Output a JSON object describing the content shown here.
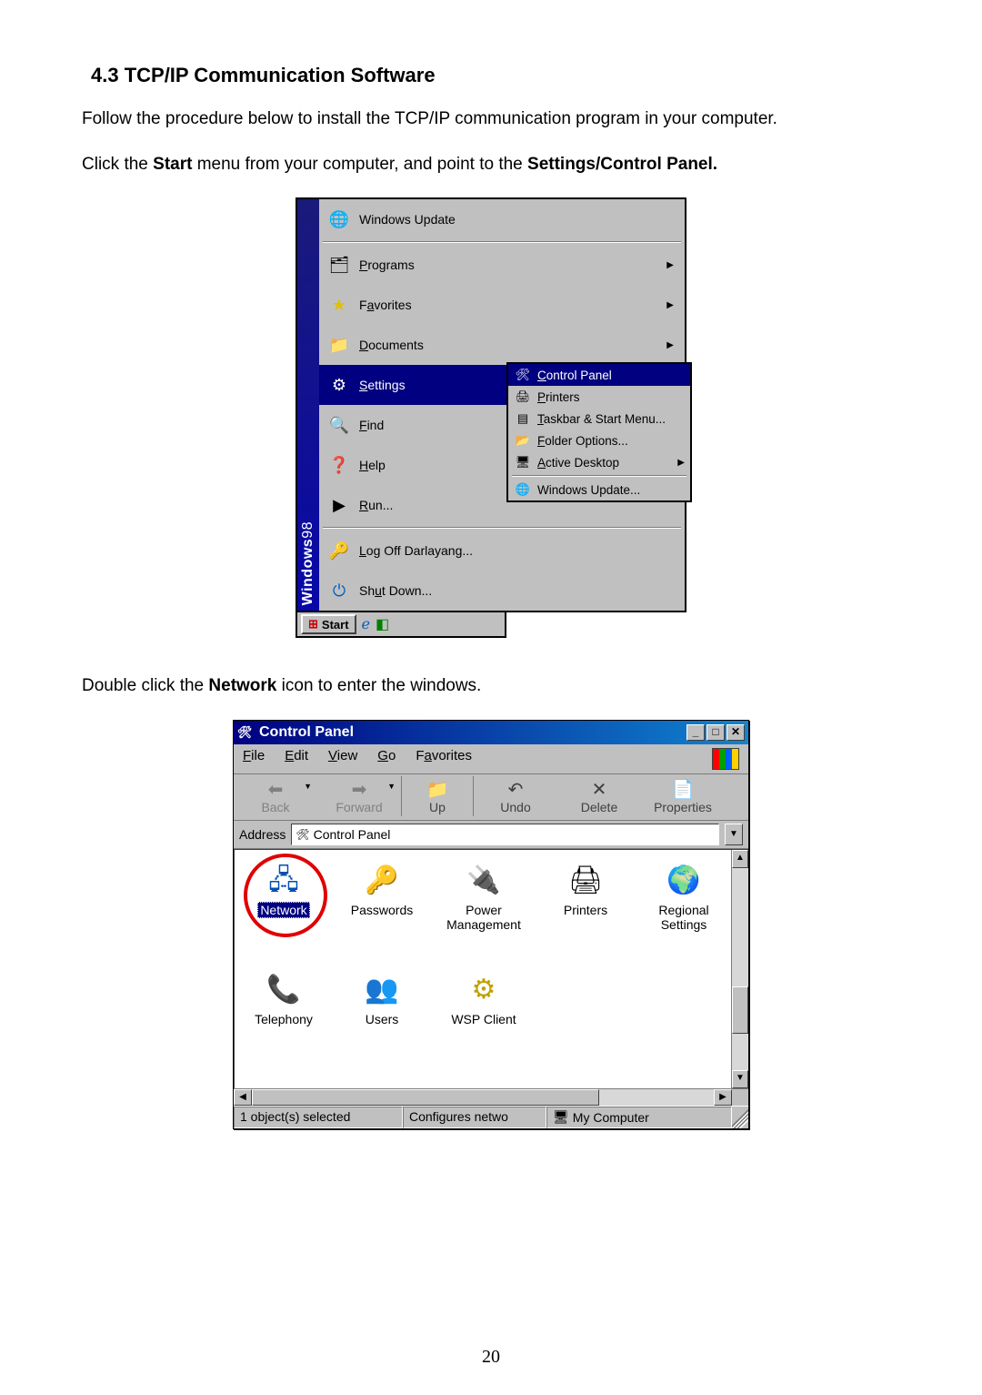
{
  "heading": "4.3 TCP/IP Communication Software",
  "intro1": "Follow the procedure below to install the TCP/IP communication program in your computer.",
  "intro2_prefix": "Click the ",
  "intro2_bold1": "Start",
  "intro2_mid": " menu from your computer, and point to the ",
  "intro2_bold2": "Settings/Control Panel.",
  "intro3_prefix": "Double click the ",
  "intro3_bold": "Network",
  "intro3_suffix": " icon to enter the windows.",
  "page_number": "20",
  "win98_brand": "Windows",
  "win98_brand_suffix": "98",
  "taskbar_start": "Start",
  "start_menu": {
    "windows_update": "Windows Update",
    "programs": "Programs",
    "favorites": "Favorites",
    "documents": "Documents",
    "settings": "Settings",
    "find": "Find",
    "help": "Help",
    "run": "Run...",
    "logoff": "Log Off Darlayang...",
    "shutdown": "Shut Down..."
  },
  "settings_submenu": {
    "control_panel": "Control Panel",
    "printers": "Printers",
    "taskbar": "Taskbar & Start Menu...",
    "folder_options": "Folder Options...",
    "active_desktop": "Active Desktop",
    "windows_update": "Windows Update..."
  },
  "control_panel": {
    "title": "Control Panel",
    "menus": {
      "file": "File",
      "edit": "Edit",
      "view": "View",
      "go": "Go",
      "favorites": "Favorites"
    },
    "tools": {
      "back": "Back",
      "forward": "Forward",
      "up": "Up",
      "undo": "Undo",
      "delete": "Delete",
      "properties": "Properties"
    },
    "address_label": "Address",
    "address_value": "Control Panel",
    "icons": {
      "network": "Network",
      "passwords": "Passwords",
      "power": "Power Management",
      "printers": "Printers",
      "regional": "Regional Settings",
      "telephony": "Telephony",
      "users": "Users",
      "wsp": "WSP Client"
    },
    "status": {
      "selected": "1 object(s) selected",
      "desc": "Configures netwo",
      "location": "My Computer"
    }
  }
}
